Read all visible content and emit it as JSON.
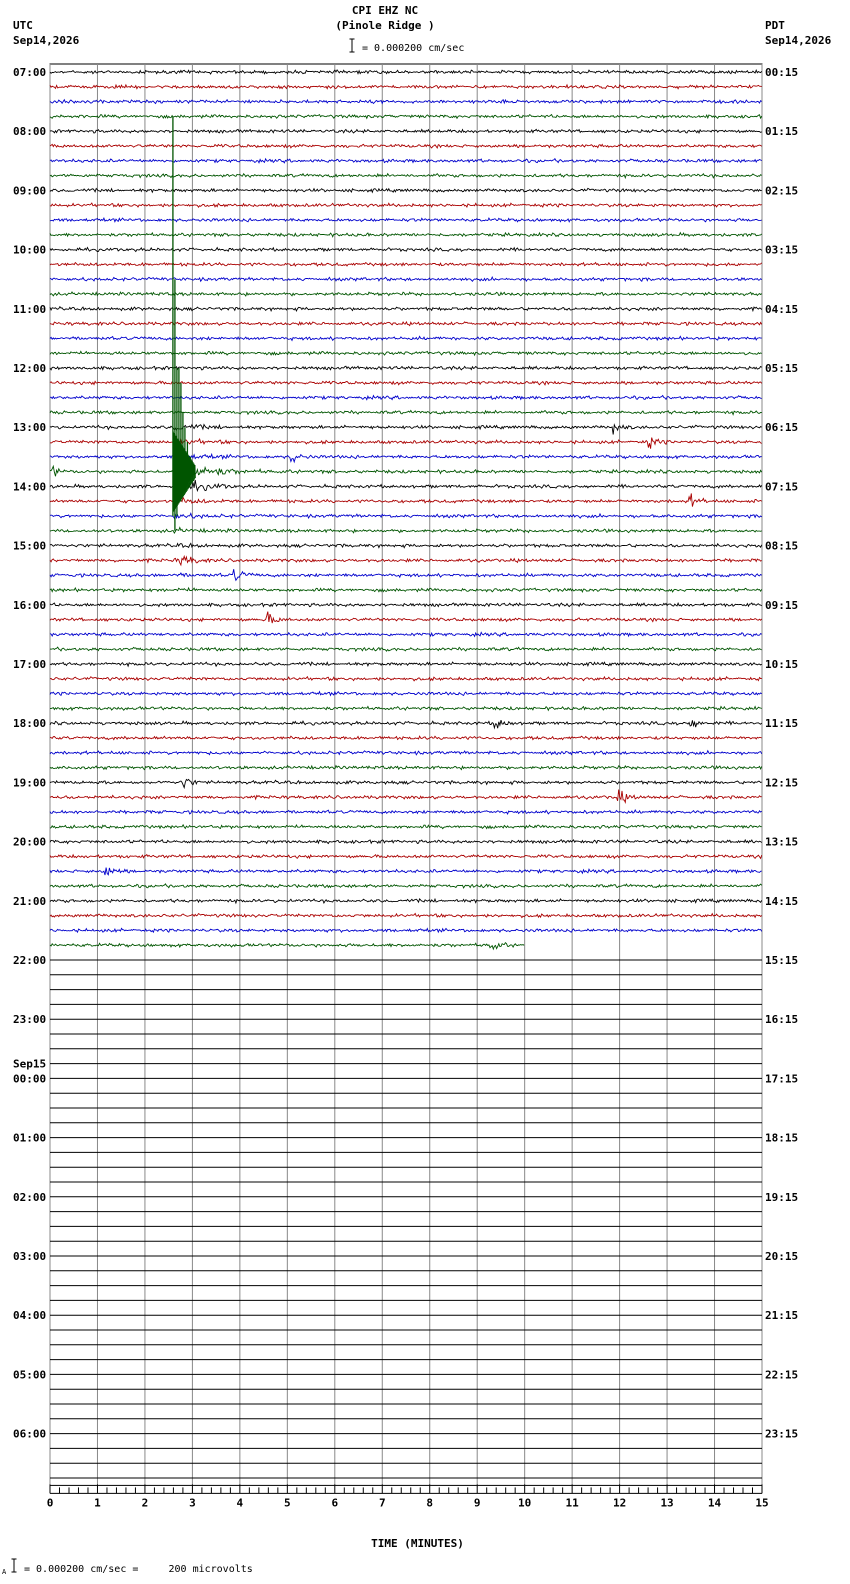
{
  "header": {
    "station": "CPI EHZ NC",
    "location": "(Pinole Ridge )",
    "scale_text": "= 0.000200 cm/sec",
    "left_zone": "UTC",
    "left_date": "Sep14,2026",
    "right_zone": "PDT",
    "right_date": "Sep14,2026"
  },
  "footer": {
    "scale_text": "= 0.000200 cm/sec =     200 microvolts",
    "marker": "A"
  },
  "chart_data": {
    "type": "line",
    "xlabel": "TIME (MINUTES)",
    "xlim": [
      0,
      15
    ],
    "x_ticks": [
      0,
      1,
      2,
      3,
      4,
      5,
      6,
      7,
      8,
      9,
      10,
      11,
      12,
      13,
      14,
      15
    ],
    "rows_per_hour": 4,
    "total_rows": 96,
    "active_rows": 60,
    "last_row_end_minute": 10,
    "trace_colors": [
      "#000000",
      "#aa0000",
      "#0000cc",
      "#005500"
    ],
    "utc_labels": [
      "07:00",
      "08:00",
      "09:00",
      "10:00",
      "11:00",
      "12:00",
      "13:00",
      "14:00",
      "15:00",
      "16:00",
      "17:00",
      "18:00",
      "19:00",
      "20:00",
      "21:00",
      "22:00",
      "23:00",
      "00:00",
      "01:00",
      "02:00",
      "03:00",
      "04:00",
      "05:00",
      "06:00"
    ],
    "utc_date_change": {
      "index": 17,
      "label": "Sep15"
    },
    "pdt_labels": [
      "00:15",
      "01:15",
      "02:15",
      "03:15",
      "04:15",
      "05:15",
      "06:15",
      "07:15",
      "08:15",
      "09:15",
      "10:15",
      "11:15",
      "12:15",
      "13:15",
      "14:15",
      "15:15",
      "16:15",
      "17:15",
      "18:15",
      "19:15",
      "20:15",
      "21:15",
      "22:15",
      "23:15"
    ],
    "event": {
      "row": 27,
      "minute": 2.6,
      "description": "large earthquake arrival with coda"
    },
    "small_events": [
      {
        "row": 24,
        "minute": 11.85
      },
      {
        "row": 25,
        "minute": 12.6
      },
      {
        "row": 26,
        "minute": 5.1
      },
      {
        "row": 29,
        "minute": 13.5
      },
      {
        "row": 33,
        "minute": 2.8
      },
      {
        "row": 34,
        "minute": 3.9
      },
      {
        "row": 37,
        "minute": 4.6
      },
      {
        "row": 44,
        "minute": 9.4
      },
      {
        "row": 44,
        "minute": 13.5
      },
      {
        "row": 48,
        "minute": 2.8
      },
      {
        "row": 49,
        "minute": 12.0
      },
      {
        "row": 54,
        "minute": 1.2
      },
      {
        "row": 59,
        "minute": 9.3
      }
    ]
  }
}
